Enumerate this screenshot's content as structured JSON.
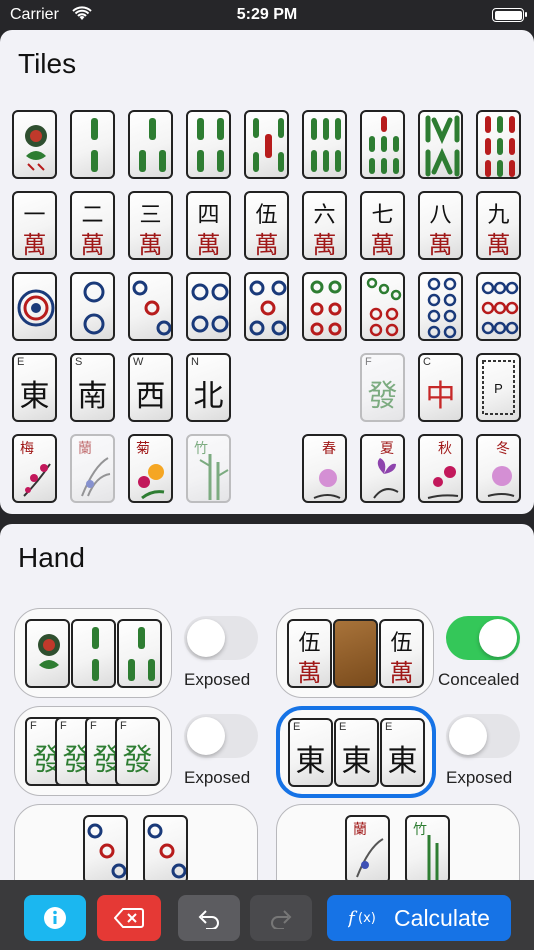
{
  "status_bar": {
    "carrier": "Carrier",
    "time": "5:29 PM"
  },
  "tiles_panel": {
    "title": "Tiles",
    "winds": [
      {
        "corner": "E",
        "glyph": "東"
      },
      {
        "corner": "S",
        "glyph": "南"
      },
      {
        "corner": "W",
        "glyph": "西"
      },
      {
        "corner": "N",
        "glyph": "北"
      }
    ],
    "dragons": [
      {
        "corner": "F",
        "glyph": "發"
      },
      {
        "corner": "C",
        "glyph": "中"
      },
      {
        "corner": "P",
        "glyph": ""
      }
    ],
    "characters": [
      "一",
      "二",
      "三",
      "四",
      "伍",
      "六",
      "七",
      "八",
      "九"
    ],
    "character_suffix": "萬",
    "flowers": [
      "梅",
      "蘭",
      "菊",
      "竹"
    ],
    "seasons": [
      "春",
      "夏",
      "秋",
      "冬"
    ]
  },
  "hand_panel": {
    "title": "Hand",
    "groups": [
      {
        "toggle_label": "Exposed"
      },
      {
        "toggle_label": "Concealed"
      },
      {
        "toggle_label": "Exposed"
      },
      {
        "toggle_label": "Exposed"
      }
    ],
    "pong_glyph": "伍",
    "pong_suffix": "萬",
    "kong_corner": "F",
    "kong_glyph": "發",
    "wind_corner": "E",
    "wind_glyph": "東",
    "flower_glyph": "蘭",
    "bamboo_glyph": "竹"
  },
  "toolbar": {
    "calculate_label": "Calculate"
  },
  "colors": {
    "accent": "#1673e6",
    "toggle_on": "#34c759",
    "info": "#1bb7f0",
    "delete": "#e53935"
  }
}
